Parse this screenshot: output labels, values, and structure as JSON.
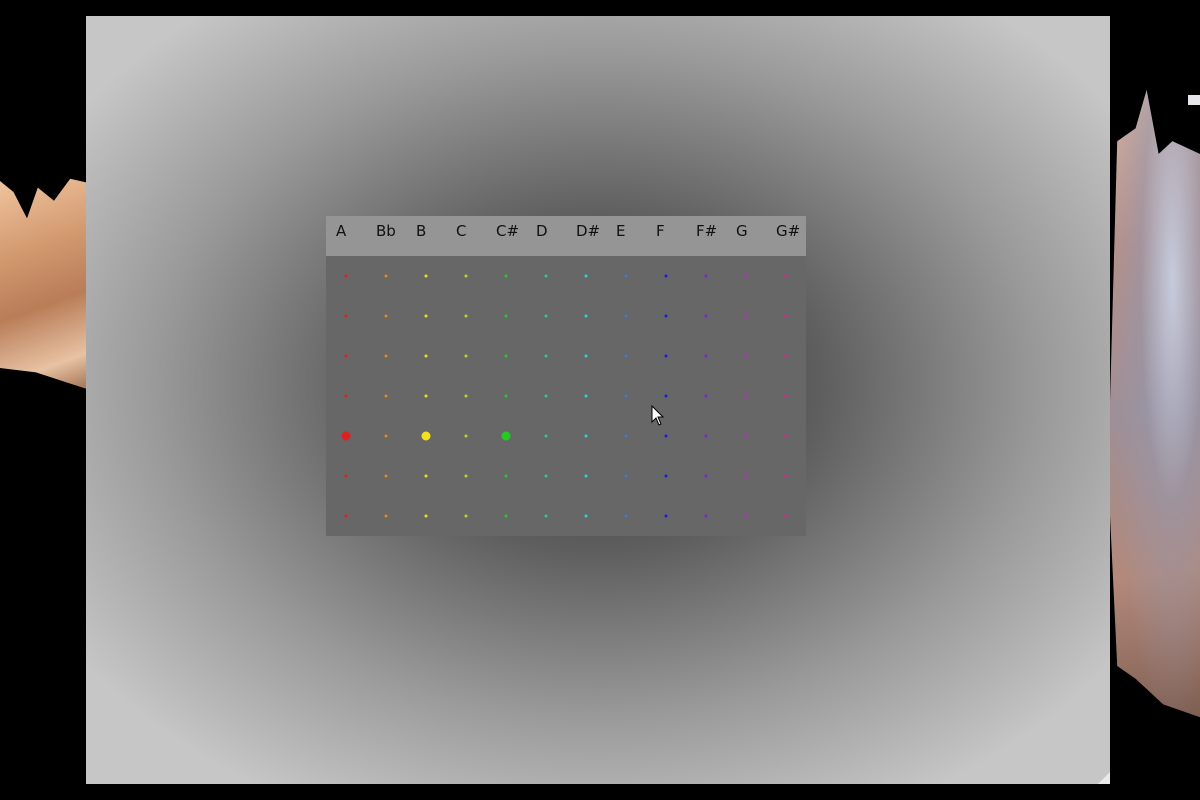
{
  "grid": {
    "notes": [
      {
        "label": "A",
        "color": "#e02020"
      },
      {
        "label": "Bb",
        "color": "#e08a20"
      },
      {
        "label": "B",
        "color": "#f0e020"
      },
      {
        "label": "C",
        "color": "#a8e020"
      },
      {
        "label": "C#",
        "color": "#22cc22"
      },
      {
        "label": "D",
        "color": "#22d088"
      },
      {
        "label": "D#",
        "color": "#22d8d8"
      },
      {
        "label": "E",
        "color": "#3a78d8"
      },
      {
        "label": "F",
        "color": "#1a1ae0"
      },
      {
        "label": "F#",
        "color": "#7a22e0"
      },
      {
        "label": "G",
        "color": "#c222d0"
      },
      {
        "label": "G#",
        "color": "#e0228a"
      }
    ],
    "row_count": 7,
    "active_row": 5,
    "active_notes": [
      "A",
      "B",
      "C#"
    ]
  }
}
